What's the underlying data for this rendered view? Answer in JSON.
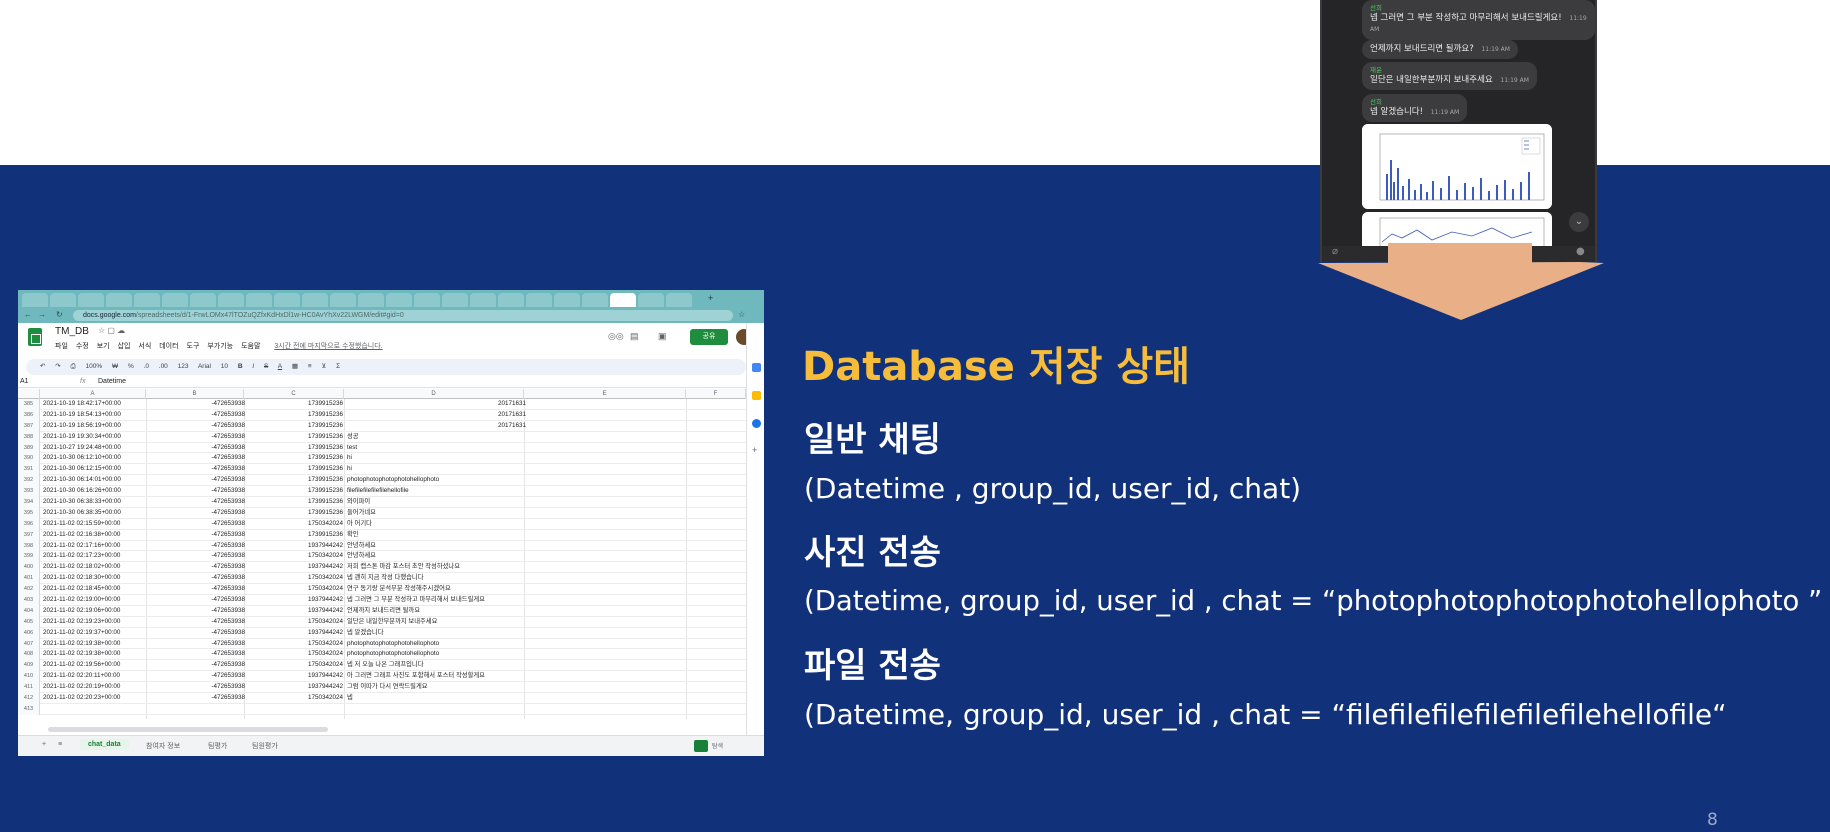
{
  "slide": {
    "heading": "Database 저장 상태",
    "sections": [
      {
        "title": "일반 채팅",
        "schema": "(Datetime , group_id, user_id, chat)"
      },
      {
        "title": "사진 전송",
        "schema": "(Datetime, group_id, user_id , chat = “photophotophotophotohellophoto ”"
      },
      {
        "title": "파일 전송",
        "schema": "(Datetime, group_id, user_id , chat = “filefilefilefilefilefilehellofile“"
      }
    ],
    "page_number": "8",
    "colors": {
      "background": "#11317a",
      "heading": "#f6bd3c",
      "text": "#ffffff",
      "arrow": "#e9b088"
    }
  },
  "chat": {
    "messages": [
      {
        "sender": "선희",
        "text": "넵 그러면 그 부분 작성하고 마무리해서 보내드릴게요!",
        "time": "11:19 AM"
      },
      {
        "sender": "",
        "text": "언제까지 보내드리면 될까요?",
        "time": "11:19 AM"
      },
      {
        "sender": "재윤",
        "text": "일단은 내일한부분까지 보내주세요",
        "time": "11:19 AM"
      },
      {
        "sender": "선희",
        "text": "넵 알겠습니다!",
        "time": "11:19 AM"
      }
    ]
  },
  "spreadsheet": {
    "url_host": "docs.google.com",
    "url_path": "/spreadsheets/d/1-FrwLOMx47lTOZuQZfxKdHxDl1w-HC0AvYhXv22LWGM/edit#gid=0",
    "doc_title": "TM_DB",
    "menu": [
      "파일",
      "수정",
      "보기",
      "삽입",
      "서식",
      "데이터",
      "도구",
      "부가기능",
      "도움말"
    ],
    "last_edit": "3시간 전에 마지막으로 수정했습니다.",
    "share_label": "공유",
    "toolbar": [
      "100%",
      "₩",
      "%",
      ".0",
      ".00",
      "123",
      "Arial",
      "10",
      "B",
      "I",
      "S",
      "A"
    ],
    "name_box": "A1",
    "formula_value": "Datetime",
    "columns": [
      "A",
      "B",
      "C",
      "D",
      "E",
      "F"
    ],
    "rows": [
      [
        "385",
        "2021-10-19 18:42:17+00:00",
        "-472653938",
        "1739915236",
        "20171631"
      ],
      [
        "386",
        "2021-10-19 18:54:13+00:00",
        "-472653938",
        "1739915236",
        "20171631"
      ],
      [
        "387",
        "2021-10-19 18:56:19+00:00",
        "-472653938",
        "1739915236",
        "20171631"
      ],
      [
        "388",
        "2021-10-19 19:30:34+00:00",
        "-472653938",
        "1739915236",
        "성공"
      ],
      [
        "389",
        "2021-10-27 19:24:48+00:00",
        "-472653938",
        "1739915236",
        "test"
      ],
      [
        "390",
        "2021-10-30 06:12:10+00:00",
        "-472653938",
        "1739915236",
        "hi"
      ],
      [
        "391",
        "2021-10-30 06:12:15+00:00",
        "-472653938",
        "1739915236",
        "hi"
      ],
      [
        "392",
        "2021-10-30 06:14:01+00:00",
        "-472653938",
        "1739915236",
        "photophotophotophotohellophoto"
      ],
      [
        "393",
        "2021-10-30 06:16:26+00:00",
        "-472653938",
        "1739915236",
        "filefilefilefilefilehellofile"
      ],
      [
        "394",
        "2021-10-30 06:38:33+00:00",
        "-472653938",
        "1739915236",
        "와이파이"
      ],
      [
        "395",
        "2021-10-30 06:38:35+00:00",
        "-472653938",
        "1739915236",
        "들어가네요"
      ],
      [
        "396",
        "2021-11-02 02:15:59+00:00",
        "-472653938",
        "1750342024",
        "아 어기다"
      ],
      [
        "397",
        "2021-11-02 02:16:38+00:00",
        "-472653938",
        "1739915236",
        "확인"
      ],
      [
        "398",
        "2021-11-02 02:17:16+00:00",
        "-472653938",
        "1937944242",
        "안녕하세요"
      ],
      [
        "399",
        "2021-11-02 02:17:23+00:00",
        "-472653938",
        "1750342024",
        "안녕하세요"
      ],
      [
        "400",
        "2021-11-02 02:18:02+00:00",
        "-472653938",
        "1937944242",
        "저희 캡스톤 마감 포스터 초안 작성하셨나요"
      ],
      [
        "401",
        "2021-11-02 02:18:30+00:00",
        "-472653938",
        "1750342024",
        "넵 괜히 지금 작성 다했습니다"
      ],
      [
        "402",
        "2021-11-02 02:18:45+00:00",
        "-472653938",
        "1750342024",
        "연구 동기랑 분석부분 작성해주시겠어요"
      ],
      [
        "403",
        "2021-11-02 02:19:00+00:00",
        "-472653938",
        "1937944242",
        "넵 그러면 그 부분 작성하고 마무리해서 보내드릴게요"
      ],
      [
        "404",
        "2021-11-02 02:19:06+00:00",
        "-472653938",
        "1937944242",
        "언제까지 보내드리면 될까요"
      ],
      [
        "405",
        "2021-11-02 02:19:23+00:00",
        "-472653938",
        "1750342024",
        "일단은 내일한부분까지 보내주세요"
      ],
      [
        "406",
        "2021-11-02 02:19:37+00:00",
        "-472653938",
        "1937944242",
        "넵 알겠습니다"
      ],
      [
        "407",
        "2021-11-02 02:19:38+00:00",
        "-472653938",
        "1750342024",
        "photophotophotophotohellophoto"
      ],
      [
        "408",
        "2021-11-02 02:19:38+00:00",
        "-472653938",
        "1750342024",
        "photophotophotophotohellophoto"
      ],
      [
        "409",
        "2021-11-02 02:19:56+00:00",
        "-472653938",
        "1750342024",
        "넵 저 오늘 나온 그래프입니다"
      ],
      [
        "410",
        "2021-11-02 02:20:11+00:00",
        "-472653938",
        "1937944242",
        "아 그러면 그래프 사진도 포함해서 포스터 작성할게요"
      ],
      [
        "411",
        "2021-11-02 02:20:19+00:00",
        "-472653938",
        "1937944242",
        "그럼 이따가 다시 연락드릴게요"
      ],
      [
        "412",
        "2021-11-02 02:20:23+00:00",
        "-472653938",
        "1750342024",
        "넵"
      ],
      [
        "413",
        "",
        "",
        "",
        ""
      ]
    ],
    "sheet_tabs": [
      "chat_data",
      "참여자 정보",
      "팀평가",
      "팀원평가"
    ],
    "explore_label": "탐색"
  }
}
